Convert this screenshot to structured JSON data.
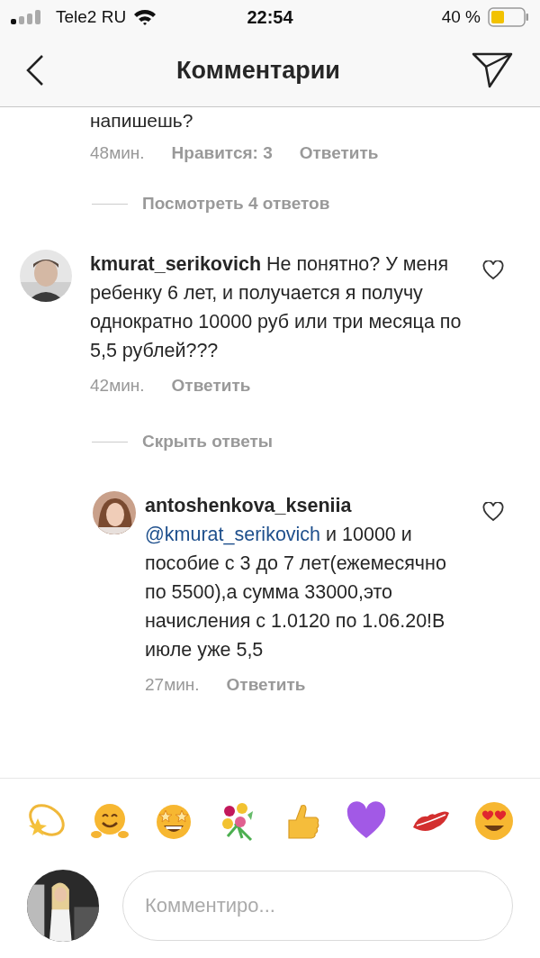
{
  "status_bar": {
    "carrier": "Tele2 RU",
    "time": "22:54",
    "battery": "40 %"
  },
  "header": {
    "title": "Комментарии"
  },
  "previous_comment": {
    "text_tail": "напишешь?",
    "time": "48мин.",
    "likes": "Нравится: 3",
    "reply": "Ответить"
  },
  "view_replies": "Посмотреть 4 ответов",
  "comments": [
    {
      "username": "kmurat_serikovich",
      "text": "Не понятно? У меня ребенку 6 лет, и получается я получу однократно 10000 руб или три месяца по 5,5 рублей???",
      "time": "42мин.",
      "reply": "Ответить",
      "liked": false,
      "replies_toggle": "Скрыть ответы",
      "replies": [
        {
          "username": "antoshenkova_kseniia",
          "mention": "@kmurat_serikovich",
          "text": "и 10000 и пособие с 3 до 7 лет(ежемесячно по 5500),а сумма 33000,это начисления с 1.0120 по 1.06.20!В июле уже 5,5",
          "time": "27мин.",
          "reply": "Ответить",
          "liked": false
        }
      ]
    }
  ],
  "composer": {
    "placeholder": "Комментиро..."
  }
}
